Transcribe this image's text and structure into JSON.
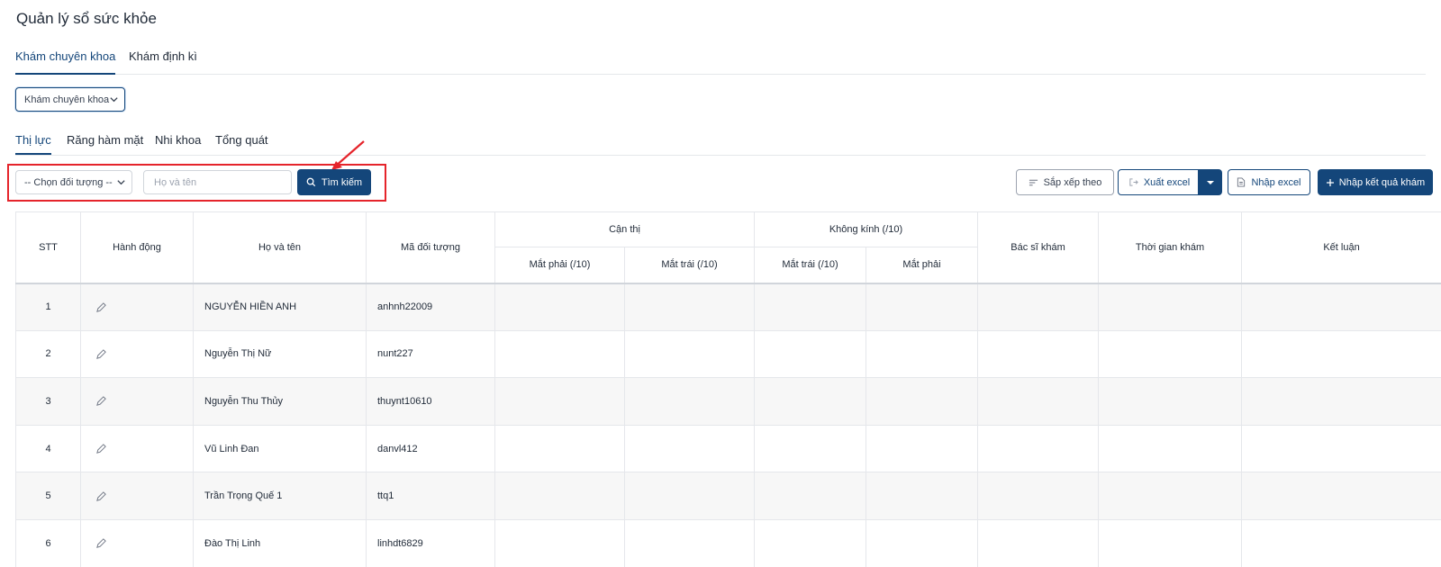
{
  "page": {
    "title": "Quản lý sổ sức khỏe"
  },
  "tabs_top": [
    "Khám chuyên khoa",
    "Khám định kì"
  ],
  "type_select": {
    "value": "Khám chuyên khoa"
  },
  "tabs_sub": [
    "Thị lực",
    "Răng hàm mặt",
    "Nhi khoa",
    "Tổng quát"
  ],
  "filters": {
    "subject_select": "-- Chọn đối tượng --",
    "name_placeholder": "Họ và tên",
    "search_label": "Tìm kiếm"
  },
  "toolbar": {
    "sort_label": "Sắp xếp theo",
    "export_label": "Xuất excel",
    "import_label": "Nhập excel",
    "add_label": "Nhập kết quả khám"
  },
  "table": {
    "headers": {
      "stt": "STT",
      "action": "Hành động",
      "name": "Họ và tên",
      "code": "Mã đối tượng",
      "myopia": "Cận thị",
      "no_glasses": "Không kính (/10)",
      "doctor": "Bác sĩ khám",
      "time": "Thời gian khám",
      "conclusion": "Kết luận",
      "myopia_right": "Mắt phải (/10)",
      "myopia_left": "Mắt trái (/10)",
      "noglass_left": "Mắt trái (/10)",
      "noglass_right": "Mắt phải"
    },
    "rows": [
      {
        "stt": "1",
        "name": "NGUYỄN HIỀN ANH",
        "code": "anhnh22009"
      },
      {
        "stt": "2",
        "name": "Nguyễn Thị Nữ",
        "code": "nunt227"
      },
      {
        "stt": "3",
        "name": "Nguyễn Thu Thủy",
        "code": "thuynt10610"
      },
      {
        "stt": "4",
        "name": "Vũ Linh Đan",
        "code": "danvl412"
      },
      {
        "stt": "5",
        "name": "Trần Trọng Quế 1",
        "code": "ttq1"
      },
      {
        "stt": "6",
        "name": "Đào Thị Linh",
        "code": "linhdt6829"
      }
    ]
  },
  "colors": {
    "primary": "#14467a",
    "highlight": "#e5242b"
  },
  "icons": [
    "chevron-down-icon",
    "search-icon",
    "sort-icon",
    "export-icon",
    "import-file-icon",
    "plus-icon",
    "pencil-icon",
    "arrow-icon"
  ]
}
